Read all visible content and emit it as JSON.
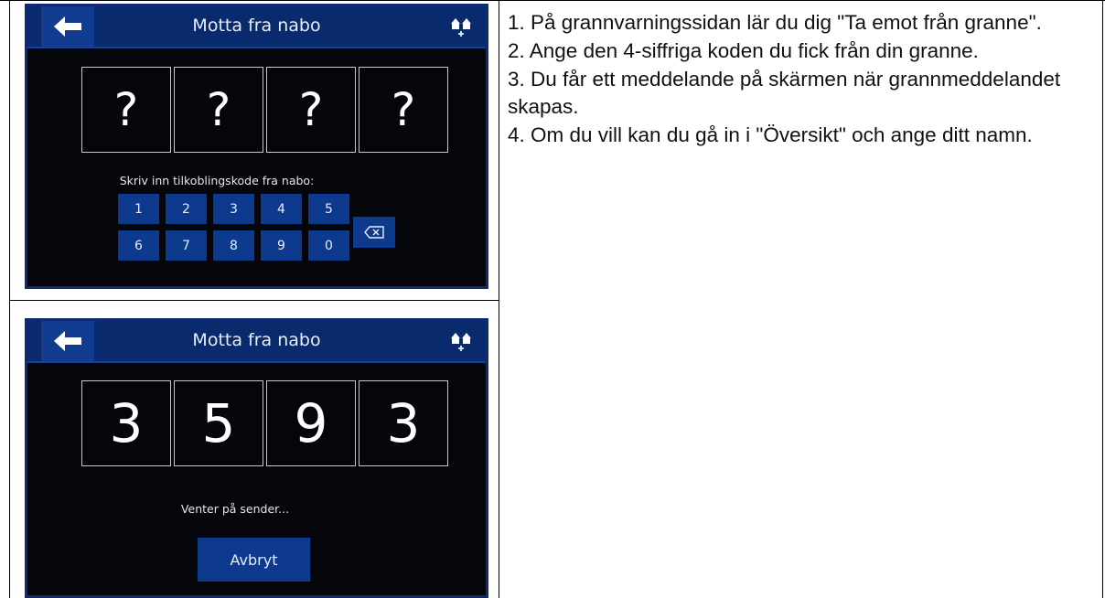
{
  "screen1": {
    "title": "Motta fra nabo",
    "digits": [
      "?",
      "?",
      "?",
      "?"
    ],
    "prompt": "Skriv inn tilkoblingskode fra nabo:",
    "keypad": [
      "1",
      "2",
      "3",
      "4",
      "5",
      "6",
      "7",
      "8",
      "9",
      "0"
    ]
  },
  "screen2": {
    "title": "Motta fra nabo",
    "digits": [
      "3",
      "5",
      "9",
      "3"
    ],
    "status": "Venter på sender...",
    "cancel_label": "Avbryt"
  },
  "instructions": [
    "1. På grannvarningssidan lär du dig \"Ta emot från granne\".",
    "2. Ange den 4-siffriga koden du fick från din granne.",
    "3. Du får ett meddelande på skärmen när grannmeddelandet skapas.",
    "4. Om du vill kan du gå in i \"Översikt\" och ange ditt namn."
  ],
  "colors": {
    "screen_bg": "#05060b",
    "bar": "#0a2a6e",
    "button": "#0d3a8c"
  },
  "icons": [
    "back-arrow-icon",
    "neighbors-icon",
    "backspace-icon"
  ]
}
